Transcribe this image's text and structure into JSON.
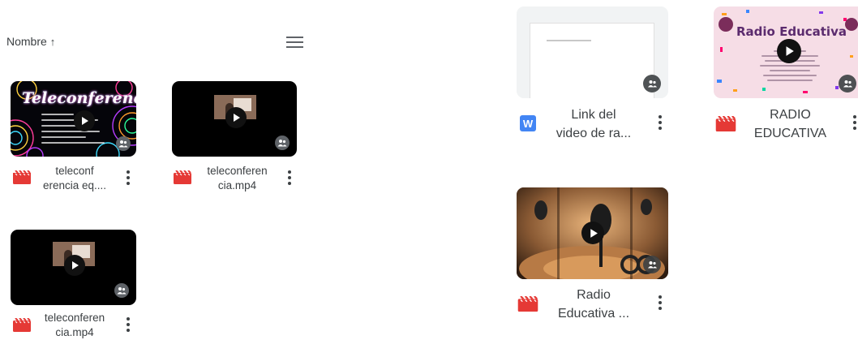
{
  "header": {
    "sort_label": "Nombre",
    "sort_arrow": "↑",
    "view_icon": "list-view-icon"
  },
  "files_left": [
    {
      "name_line1": "teleconf",
      "name_line2": "erencia eq....",
      "type_icon": "video-file-icon",
      "thumb_title": "Teleconferencia"
    },
    {
      "name_line1": "teleconferen",
      "name_line2": "cia.mp4",
      "type_icon": "video-file-icon"
    },
    {
      "name_line1": "teleconferen",
      "name_line2": "cia.mp4",
      "type_icon": "video-file-icon"
    }
  ],
  "files_right": [
    {
      "name_line1": "Link del",
      "name_line2": "video de ra...",
      "type_icon": "word-doc-icon",
      "type_letter": "W"
    },
    {
      "name_line1": "RADIO",
      "name_line2": "EDUCATIVA",
      "type_icon": "video-file-icon",
      "thumb_title": "Radio Educativa"
    },
    {
      "name_line1": "Radio",
      "name_line2": "Educativa ...",
      "type_icon": "video-file-icon"
    }
  ],
  "colors": {
    "video_icon": "#e53935",
    "word_icon": "#4285f4",
    "text": "#3c4043",
    "badge": "#5f6368"
  }
}
